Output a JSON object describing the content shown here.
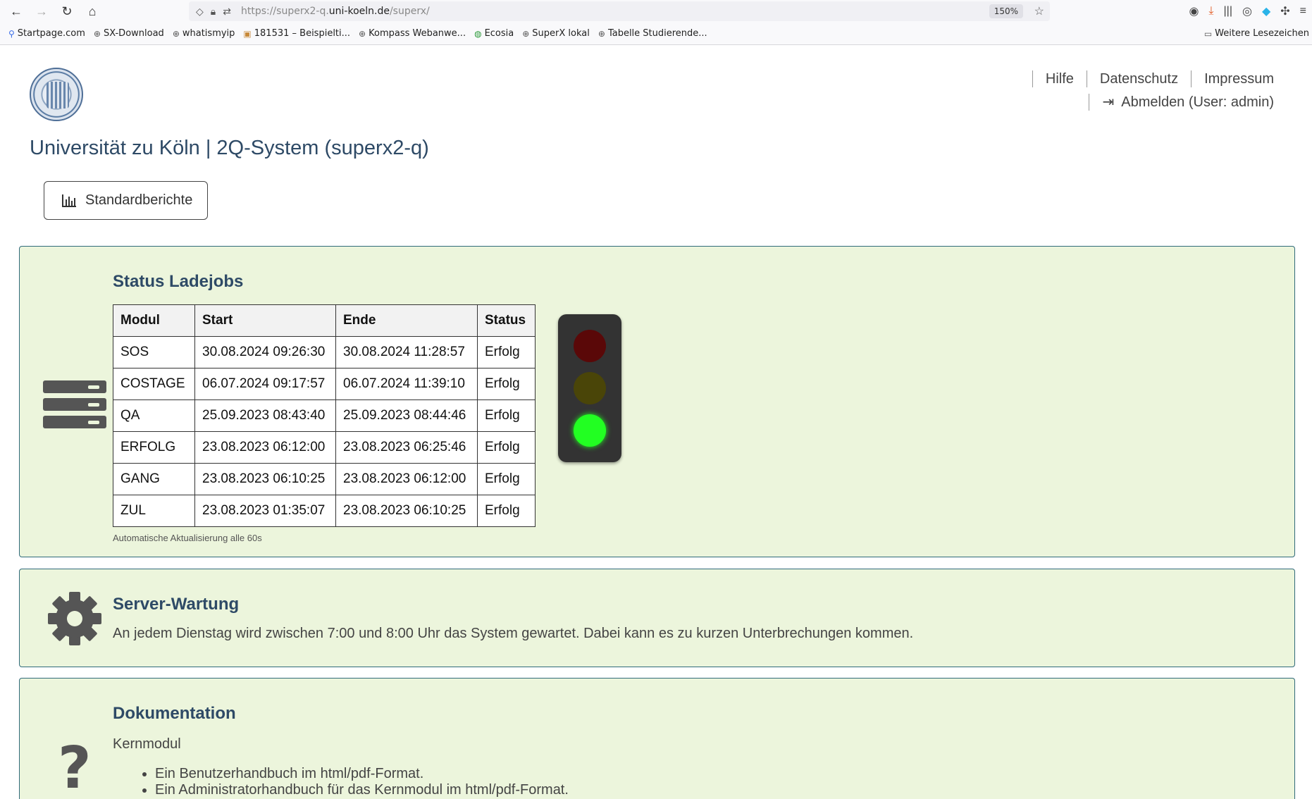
{
  "browser": {
    "url_prefix": "https://superx2-q.",
    "url_host": "uni-koeln.de",
    "url_path": "/superx/",
    "zoom": "150%",
    "bookmarks": [
      "Startpage.com",
      "SX-Download",
      "whatismyip",
      "181531 – Beispielti...",
      "Kompass Webanwe...",
      "Ecosia",
      "SuperX lokal",
      "Tabelle Studierende..."
    ],
    "other_bookmarks": "Weitere Lesezeichen"
  },
  "header": {
    "nav": [
      "Hilfe",
      "Datenschutz",
      "Impressum"
    ],
    "logout": "Abmelden (User: admin)",
    "title": "Universität zu Köln | 2Q-System (superx2-q)",
    "std_button": "Standardberichte"
  },
  "status": {
    "heading": "Status Ladejobs",
    "columns": [
      "Modul",
      "Start",
      "Ende",
      "Status"
    ],
    "rows": [
      [
        "SOS",
        "30.08.2024 09:26:30",
        "30.08.2024 11:28:57",
        "Erfolg"
      ],
      [
        "COSTAGE",
        "06.07.2024 09:17:57",
        "06.07.2024 11:39:10",
        "Erfolg"
      ],
      [
        "QA",
        "25.09.2023 08:43:40",
        "25.09.2023 08:44:46",
        "Erfolg"
      ],
      [
        "ERFOLG",
        "23.08.2023 06:12:00",
        "23.08.2023 06:25:46",
        "Erfolg"
      ],
      [
        "GANG",
        "23.08.2023 06:10:25",
        "23.08.2023 06:12:00",
        "Erfolg"
      ],
      [
        "ZUL",
        "23.08.2023 01:35:07",
        "23.08.2023 06:10:25",
        "Erfolg"
      ]
    ],
    "note": "Automatische Aktualisierung alle 60s",
    "traffic_light": "green"
  },
  "maintenance": {
    "heading": "Server-Wartung",
    "text": "An jedem Dienstag wird zwischen 7:00 und 8:00 Uhr das System gewartet. Dabei kann es zu kurzen Unterbrechungen kommen."
  },
  "docs": {
    "heading": "Dokumentation",
    "sub": "Kernmodul",
    "items": [
      "Ein Benutzerhandbuch im html/pdf-Format.",
      "Ein Administratorhandbuch für das Kernmodul im html/pdf-Format."
    ]
  }
}
